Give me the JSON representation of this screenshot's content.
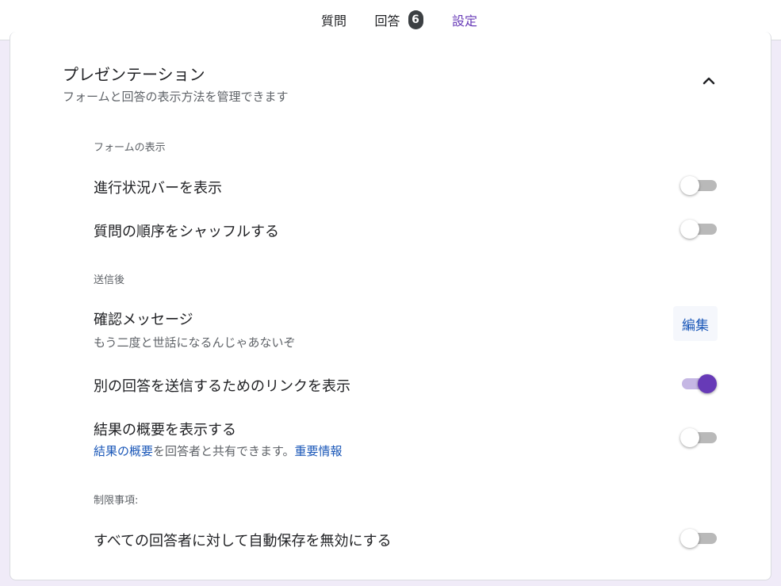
{
  "tabs": {
    "questions": "質問",
    "responses": "回答",
    "responses_count": "6",
    "settings": "設定"
  },
  "presentation": {
    "title": "プレゼンテーション",
    "description": "フォームと回答の表示方法を管理できます"
  },
  "form_display": {
    "heading": "フォームの表示",
    "show_progress_bar": {
      "label": "進行状況バーを表示",
      "enabled": false
    },
    "shuffle_questions": {
      "label": "質問の順序をシャッフルする",
      "enabled": false
    }
  },
  "after_submit": {
    "heading": "送信後",
    "confirmation": {
      "label": "確認メッセージ",
      "message": "もう二度と世話になるんじゃあないぞ",
      "edit_label": "編集"
    },
    "show_resubmit_link": {
      "label": "別の回答を送信するためのリンクを表示",
      "enabled": true
    },
    "show_summary": {
      "label": "結果の概要を表示する",
      "sub_link": "結果の概要",
      "sub_text": "を回答者と共有できます。",
      "learn_more": "重要情報",
      "enabled": false
    }
  },
  "restrictions": {
    "heading": "制限事項:",
    "disable_autosave": {
      "label": "すべての回答者に対して自動保存を無効にする",
      "enabled": false
    }
  },
  "colors": {
    "accent": "#673ab7",
    "link": "#1a57b8",
    "background": "#f0ebf8"
  }
}
